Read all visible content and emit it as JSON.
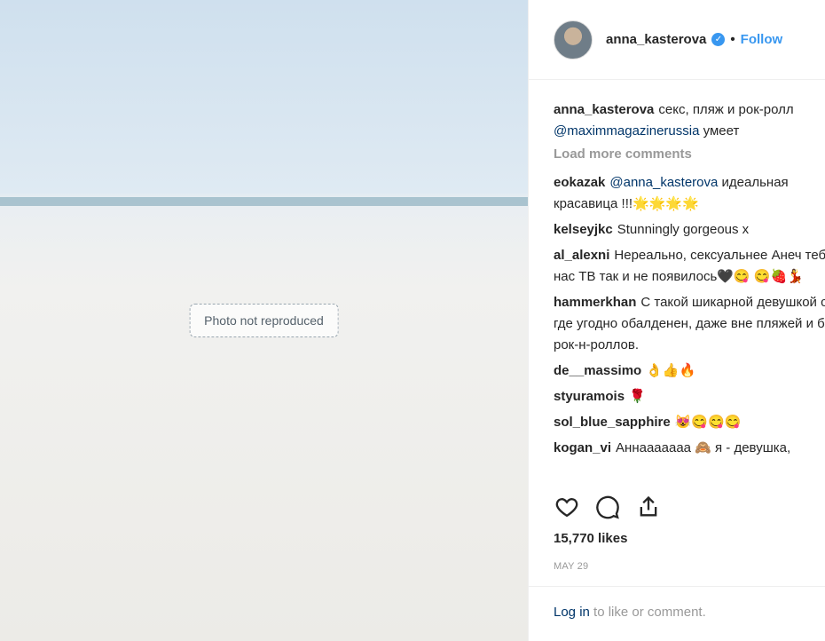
{
  "media": {
    "placeholder_text": "Photo not reproduced"
  },
  "header": {
    "username": "anna_kasterova",
    "verified_icon": "verified-badge-icon",
    "separator": "•",
    "follow_label": "Follow"
  },
  "caption": {
    "username": "anna_kasterova",
    "text_1": "секс, пляж и рок-ролл",
    "mention": "@maximmagazinerussia",
    "text_2": "умеет"
  },
  "load_more": "Load more comments",
  "comments": [
    {
      "user": "eokazak",
      "mention": "@anna_kasterova",
      "text": "идеальная красавица !!!🌟🌟🌟🌟"
    },
    {
      "user": "kelseyjkc",
      "mention": "",
      "text": "Stunningly gorgeous x"
    },
    {
      "user": "al_alexni",
      "mention": "",
      "text": "Нереально, сексуальнее Анеч тебя у нас ТВ так и не появилось🖤😋 😋🍓💃"
    },
    {
      "user": "hammerkhan",
      "mention": "",
      "text": "С такой шикарной девушкой секс где угодно обалденен, даже вне пляжей и без рок-н-роллов."
    },
    {
      "user": "de__massimo",
      "mention": "",
      "text": "👌👍🔥"
    },
    {
      "user": "styuramois",
      "mention": "",
      "text": "🌹"
    },
    {
      "user": "sol_blue_sapphire",
      "mention": "",
      "text": "😻😋😋😋"
    },
    {
      "user": "kogan_vi",
      "mention": "",
      "text": "Аннааааааа 🙈 я - девушка,"
    }
  ],
  "actions": {
    "like_icon": "heart-icon",
    "comment_icon": "comment-bubble-icon",
    "share_icon": "share-icon"
  },
  "likes": "15,770 likes",
  "date": "MAY 29",
  "login": {
    "link_label": "Log in",
    "rest_text": "to like or comment."
  }
}
